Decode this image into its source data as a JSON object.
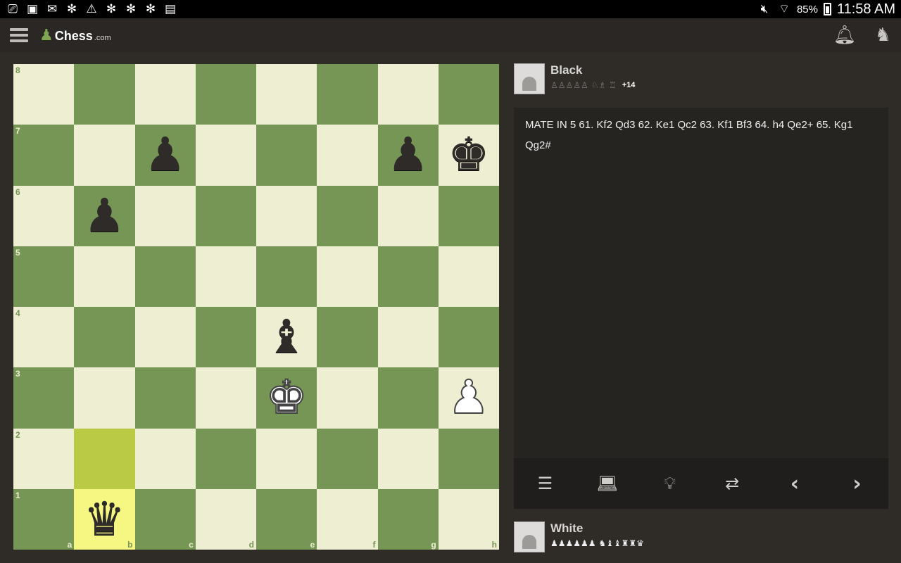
{
  "status_bar": {
    "left_icons": [
      "cast-icon",
      "image-icon",
      "gmail-icon",
      "snowflake-icon",
      "warning-icon",
      "snowflake-icon",
      "snowflake-icon",
      "snowflake-icon",
      "clipboard-icon"
    ],
    "battery": "85%",
    "time": "11:58 AM"
  },
  "app_bar": {
    "logo_text": "Chess",
    "logo_suffix": ".com"
  },
  "board": {
    "ranks": [
      "8",
      "7",
      "6",
      "5",
      "4",
      "3",
      "2",
      "1"
    ],
    "files": [
      "a",
      "b",
      "c",
      "d",
      "e",
      "f",
      "g",
      "h"
    ],
    "highlighted": [
      "b2",
      "b1"
    ],
    "pieces": [
      {
        "square": "c7",
        "glyph": "♟",
        "color": "black",
        "name": "black-pawn"
      },
      {
        "square": "g7",
        "glyph": "♟",
        "color": "black",
        "name": "black-pawn"
      },
      {
        "square": "h7",
        "glyph": "♚",
        "color": "black",
        "name": "black-king"
      },
      {
        "square": "b6",
        "glyph": "♟",
        "color": "black",
        "name": "black-pawn"
      },
      {
        "square": "e4",
        "glyph": "♝",
        "color": "black",
        "name": "black-bishop"
      },
      {
        "square": "e3",
        "glyph": "♚",
        "color": "white",
        "name": "white-king"
      },
      {
        "square": "h3",
        "glyph": "♟",
        "color": "white",
        "name": "white-pawn"
      },
      {
        "square": "b1",
        "glyph": "♛",
        "color": "black",
        "name": "black-queen"
      }
    ],
    "colors": {
      "light": "#eeeed2",
      "dark": "#769656",
      "highlight_light": "#f6f682",
      "highlight_dark": "#baca44"
    }
  },
  "black_player": {
    "name": "Black",
    "captured": "♙♙♙♙♙  ♘♗  ♖",
    "material": "+14"
  },
  "white_player": {
    "name": "White",
    "captured": "♟♟♟♟♟♟  ♞♝♝♜♜♛"
  },
  "moves_text": "MATE IN 5  61. Kf2 Qd3  62. Ke1 Qc2  63. Kf1 Bf3  64. h4 Qe2+  65. Kg1 Qg2#",
  "controls": [
    "move-list-icon",
    "computer-icon",
    "hint-lightbulb-icon",
    "flip-board-icon",
    "previous-move-icon",
    "next-move-icon"
  ]
}
